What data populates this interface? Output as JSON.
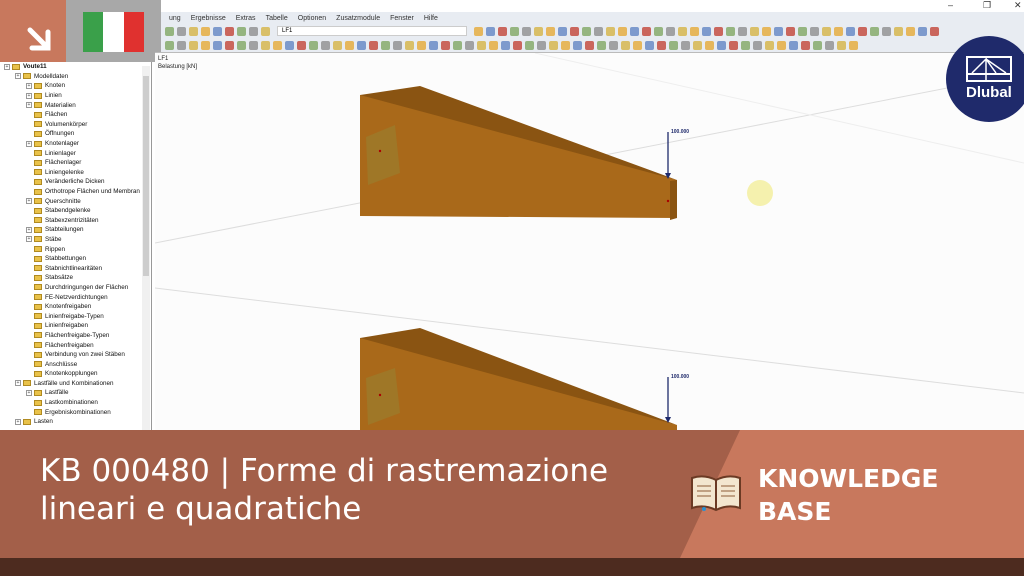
{
  "menu": [
    "ung",
    "Ergebnisse",
    "Extras",
    "Tabelle",
    "Optionen",
    "Zusatzmodule",
    "Fenster",
    "Hilfe"
  ],
  "toolbar": {
    "load_case": "LF1"
  },
  "viewport": {
    "case": "LF1",
    "label": "Belastung [kN]",
    "load1": "100.000",
    "load2": "100.000"
  },
  "tree": [
    {
      "l": 0,
      "t": "Voute11",
      "e": true
    },
    {
      "l": 1,
      "t": "Modelldaten",
      "e": true
    },
    {
      "l": 2,
      "t": "Knoten",
      "e": true
    },
    {
      "l": 2,
      "t": "Linien",
      "e": true
    },
    {
      "l": 2,
      "t": "Materialien",
      "e": true
    },
    {
      "l": 2,
      "t": "Flächen"
    },
    {
      "l": 2,
      "t": "Volumenkörper"
    },
    {
      "l": 2,
      "t": "Öffnungen"
    },
    {
      "l": 2,
      "t": "Knotenlager",
      "e": true
    },
    {
      "l": 2,
      "t": "Linienlager"
    },
    {
      "l": 2,
      "t": "Flächenlager"
    },
    {
      "l": 2,
      "t": "Liniengelenke"
    },
    {
      "l": 2,
      "t": "Veränderliche Dicken"
    },
    {
      "l": 2,
      "t": "Orthotrope Flächen und Membran"
    },
    {
      "l": 2,
      "t": "Querschnitte",
      "e": true
    },
    {
      "l": 2,
      "t": "Stabendgelenke"
    },
    {
      "l": 2,
      "t": "Stabexzentrizitäten"
    },
    {
      "l": 2,
      "t": "Stabteilungen",
      "e": true
    },
    {
      "l": 2,
      "t": "Stäbe",
      "e": true
    },
    {
      "l": 2,
      "t": "Rippen"
    },
    {
      "l": 2,
      "t": "Stabbettungen"
    },
    {
      "l": 2,
      "t": "Stabnichtlinearitäten"
    },
    {
      "l": 2,
      "t": "Stabsätze"
    },
    {
      "l": 2,
      "t": "Durchdringungen der Flächen"
    },
    {
      "l": 2,
      "t": "FE-Netzverdichtungen"
    },
    {
      "l": 2,
      "t": "Knotenfreigaben"
    },
    {
      "l": 2,
      "t": "Linienfreigabe-Typen"
    },
    {
      "l": 2,
      "t": "Linienfreigaben"
    },
    {
      "l": 2,
      "t": "Flächenfreigabe-Typen"
    },
    {
      "l": 2,
      "t": "Flächenfreigaben"
    },
    {
      "l": 2,
      "t": "Verbindung von zwei Stäben"
    },
    {
      "l": 2,
      "t": "Anschlüsse"
    },
    {
      "l": 2,
      "t": "Knotenkopplungen"
    },
    {
      "l": 1,
      "t": "Lastfälle und Kombinationen",
      "e": true
    },
    {
      "l": 2,
      "t": "Lastfälle",
      "e": true
    },
    {
      "l": 2,
      "t": "Lastkombinationen"
    },
    {
      "l": 2,
      "t": "Ergebniskombinationen"
    },
    {
      "l": 1,
      "t": "Lasten",
      "e": true
    }
  ],
  "logo": "Dlubal",
  "banner": {
    "title_line1": "KB 000480 | Forme di rastremazione",
    "title_line2": "lineari e quadratiche",
    "kb_line1": "KNOWLEDGE",
    "kb_line2": "BASE"
  },
  "colors": {
    "banner": "#a35f49",
    "accent": "#c8785d",
    "dark": "#4d2b1f",
    "beam": "#a9691a",
    "dlubal": "#1f2a6b"
  }
}
